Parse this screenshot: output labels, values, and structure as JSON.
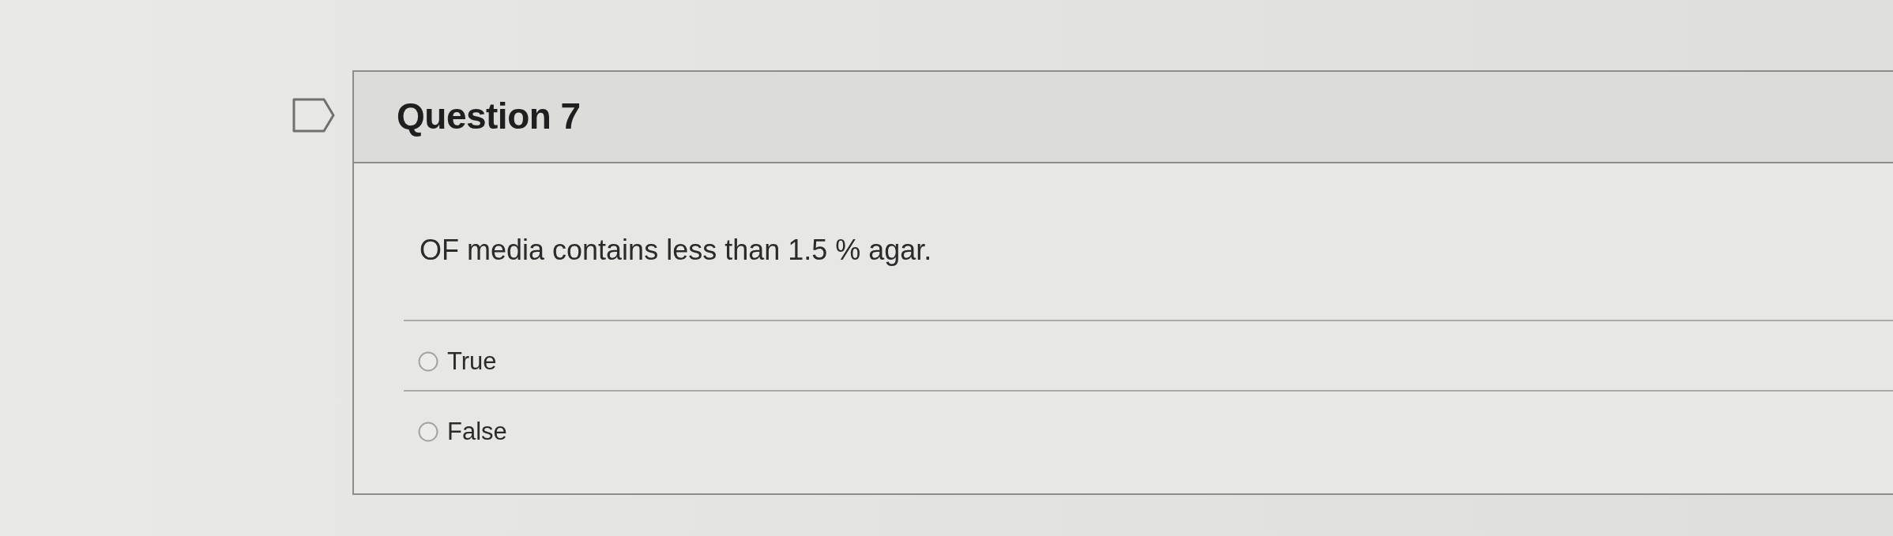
{
  "question": {
    "title": "Question 7",
    "flagged": false
  },
  "prompt": "OF media contains less than 1.5 % agar.",
  "answers": [
    {
      "label": "True",
      "selected": false
    },
    {
      "label": "False",
      "selected": false
    }
  ]
}
